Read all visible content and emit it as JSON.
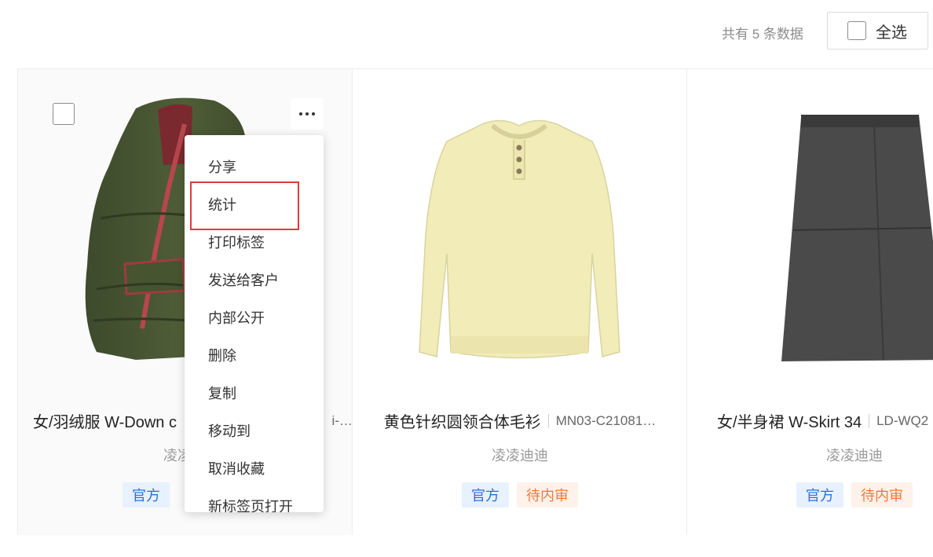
{
  "header": {
    "count_text": "共有 5 条数据",
    "select_all_label": "全选"
  },
  "cards": [
    {
      "title": "女/羽绒服 W-Down c",
      "code": "i-…",
      "brand": "凌凌",
      "tags": [
        "官方"
      ]
    },
    {
      "title": "黄色针织圆领合体毛衫",
      "code": "MN03-C21081…",
      "brand": "凌凌迪迪",
      "tags": [
        "官方",
        "待内审"
      ]
    },
    {
      "title": "女/半身裙 W-Skirt 34",
      "code": "LD-WQ2",
      "brand": "凌凌迪迪",
      "tags": [
        "官方",
        "待内审"
      ]
    }
  ],
  "menu": {
    "items": [
      "分享",
      "统计",
      "打印标签",
      "发送给客户",
      "内部公开",
      "删除",
      "复制",
      "移动到",
      "取消收藏",
      "新标签页打开"
    ],
    "highlighted": "统计"
  },
  "colors": {
    "official_tag_bg": "#e8f1ff",
    "official_tag_text": "#2f6fd6",
    "pending_tag_bg": "#fff2ea",
    "pending_tag_text": "#f07a3a",
    "highlight_border": "#e0393e"
  }
}
